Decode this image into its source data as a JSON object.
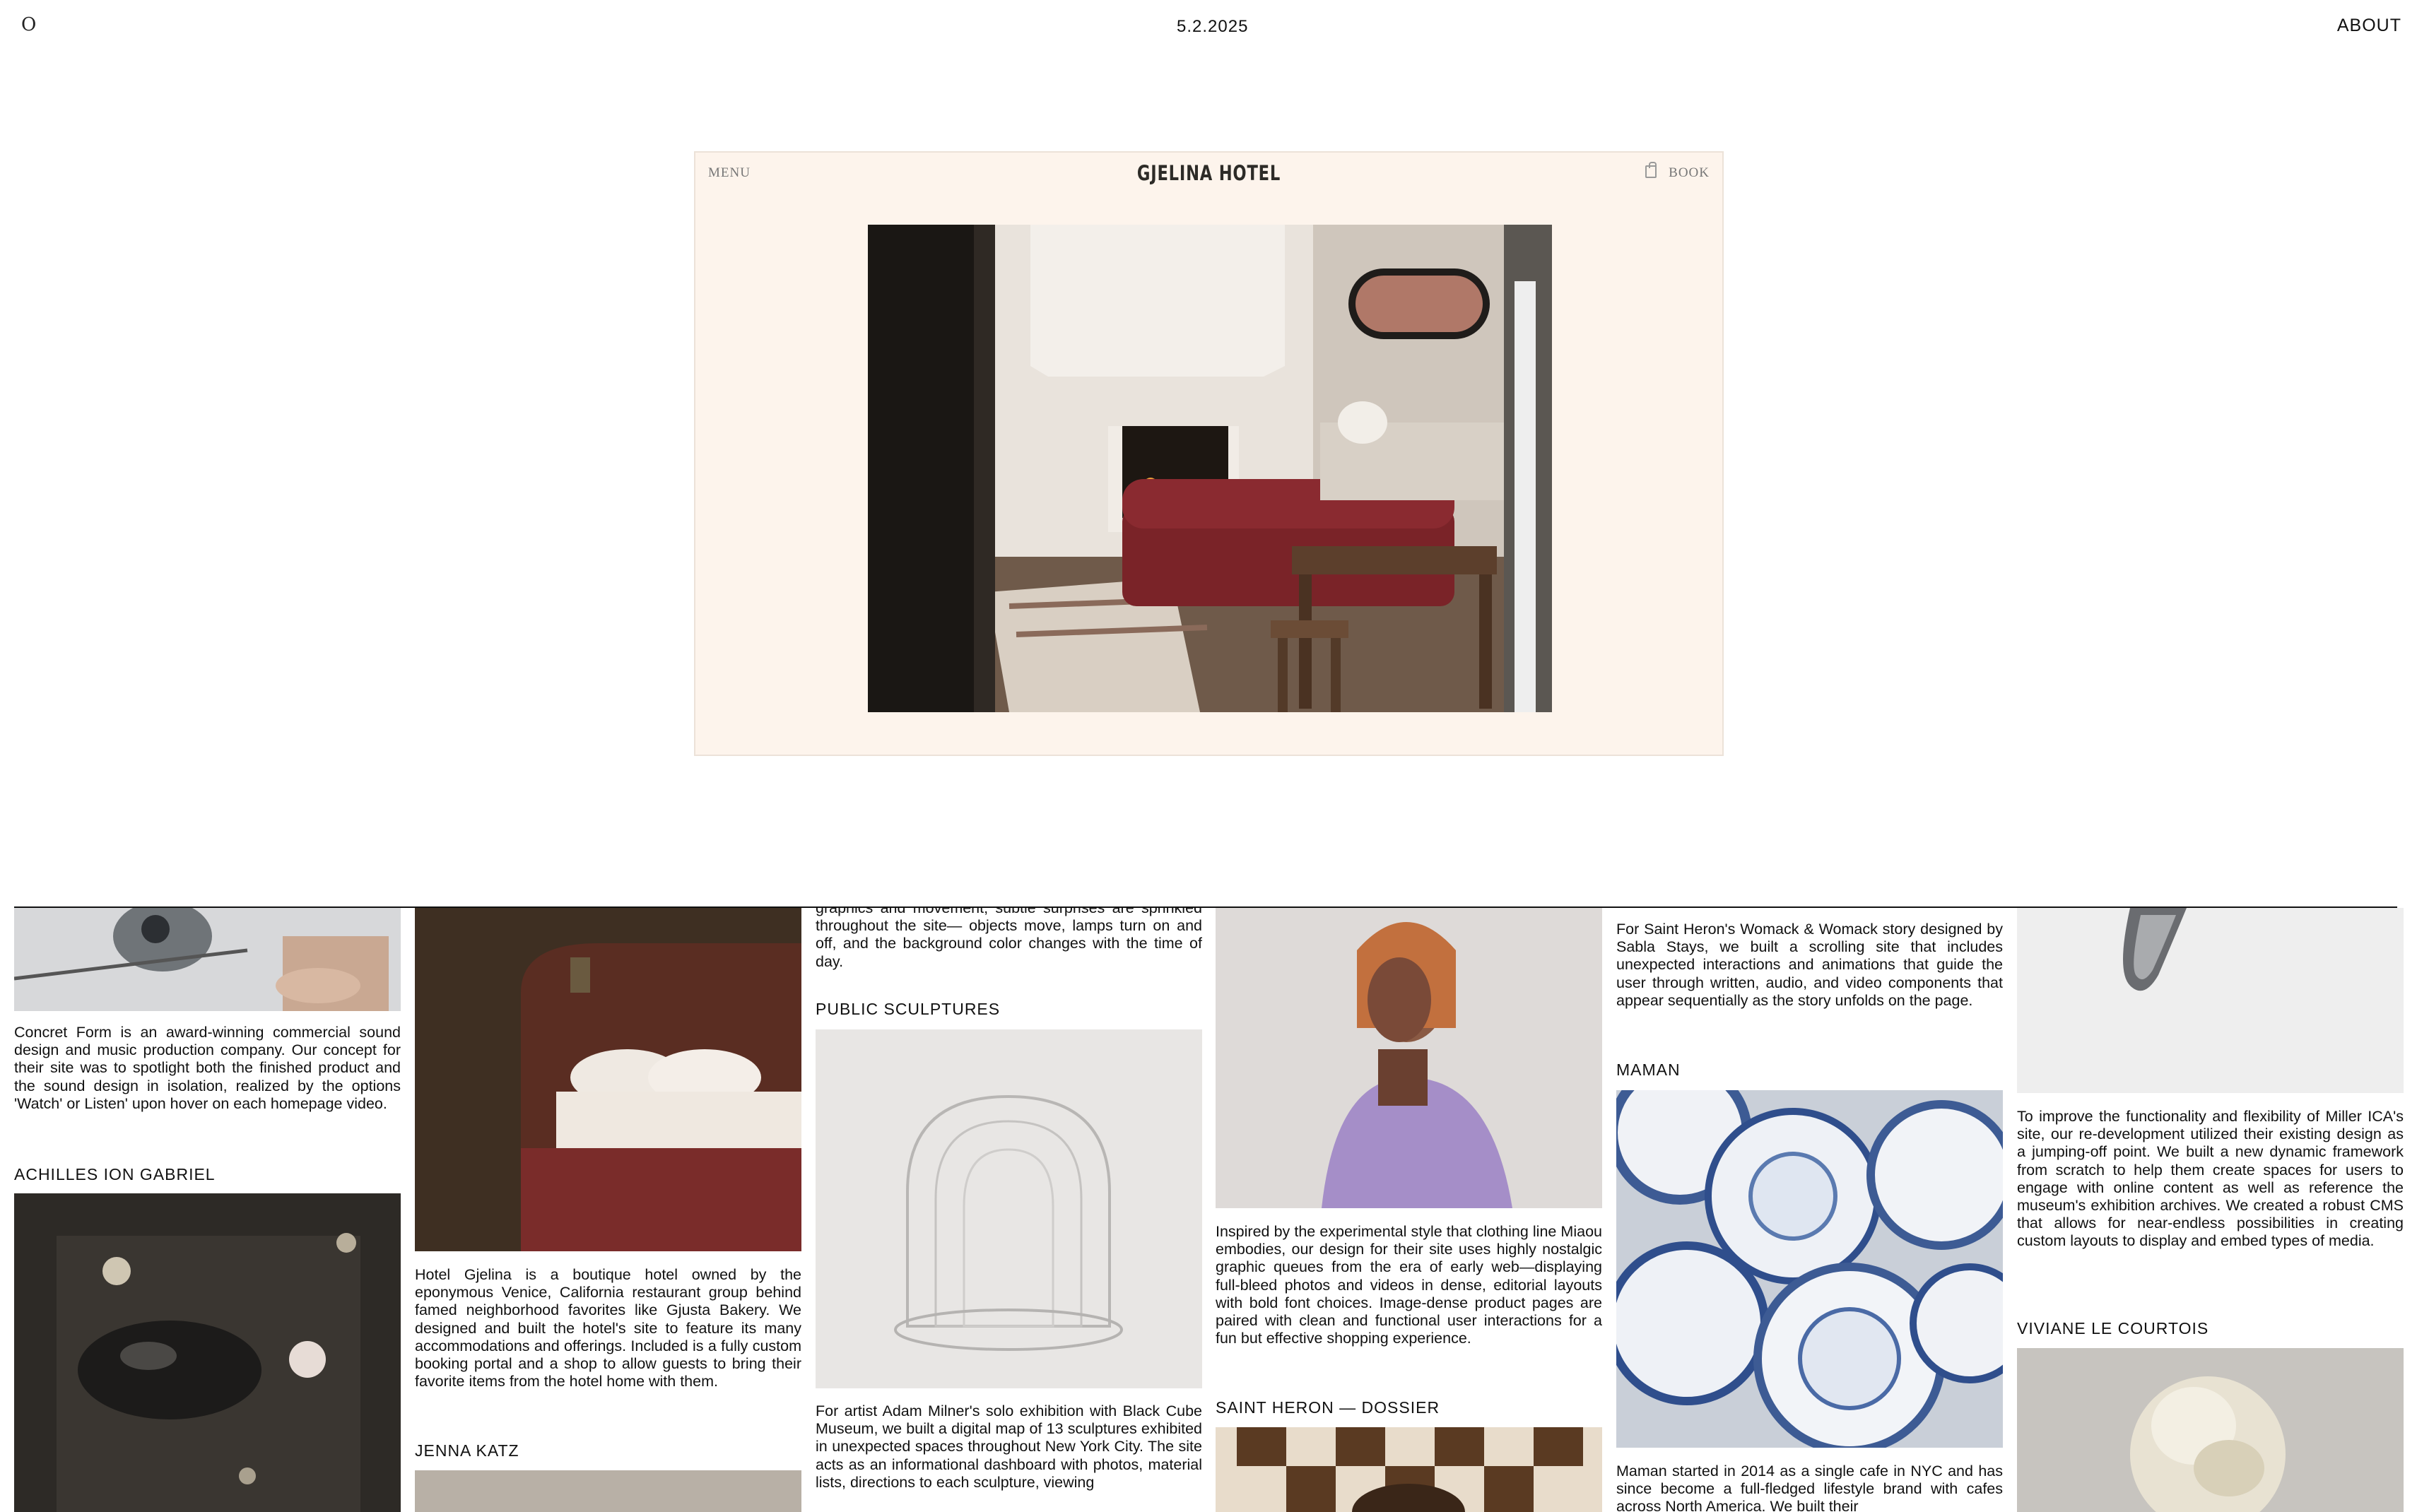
{
  "header": {
    "logo": "O",
    "date": "5.2.2025",
    "about_label": "ABOUT"
  },
  "featured": {
    "menu_label": "MENU",
    "site_title": "GJELINA HOTEL",
    "book_label": "BOOK"
  },
  "columns": [
    {
      "items": [
        {
          "text": "Concret Form is an award-winning commercial sound design and music production company. Our concept for their site was to spotlight both the finished product and the sound design in isolation, realized by the options 'Watch' or Listen' upon hover on each homepage video."
        },
        {
          "title": "ACHILLES ION GABRIEL"
        }
      ]
    },
    {
      "items": [
        {
          "text": "Hotel Gjelina is a boutique hotel owned by the eponymous Venice, California restaurant group behind famed neighborhood favorites like Gjusta Bakery. We designed and built the hotel's site to feature its many accommodations and offerings. Included is a fully custom booking portal and a shop to allow guests to bring their favorite items from the hotel home with them."
        },
        {
          "title": "JENNA KATZ"
        }
      ]
    },
    {
      "items": [
        {
          "text_top": "graphics and movement; subtle surprises are sprinkled throughout the site— objects move, lamps turn on and off, and the background color changes with the time of day."
        },
        {
          "title": "PUBLIC SCULPTURES"
        },
        {
          "text": "For artist Adam Milner's solo exhibition with Black Cube Museum, we built a digital map of 13 sculptures exhibited in unexpected spaces throughout New York City. The site acts as an informational dashboard with photos, material lists, directions to each sculpture, viewing"
        }
      ]
    },
    {
      "items": [
        {
          "text": "Inspired by the experimental style that clothing line Miaou embodies, our design for their site uses highly nostalgic graphic queues from the era of early web—displaying full-bleed photos and videos in dense, editorial layouts with bold font choices. Image-dense product pages are paired with clean and functional user interactions for a fun but effective shopping experience."
        },
        {
          "title": "SAINT HERON — DOSSIER"
        }
      ]
    },
    {
      "items": [
        {
          "text_top": "For Saint Heron's Womack & Womack story designed by Sabla Stays, we built a scrolling site that includes unexpected interactions and animations that guide the user through written, audio, and video components that appear sequentially as the story unfolds on the page."
        },
        {
          "title": "MAMAN"
        },
        {
          "text": "Maman started in 2014 as a single cafe in NYC and has since become a full-fledged lifestyle brand with cafes across North America. We built their"
        }
      ]
    },
    {
      "items": [
        {
          "text": "To improve the functionality and flexibility of Miller ICA's site, our re-development utilized their existing design as a jumping-off point. We built a new dynamic framework from scratch to help them create spaces for users to engage with online content as well as reference the museum's exhibition archives. We created a robust CMS that allows for near-endless possibilities in creating custom layouts to display and embed types of media."
        },
        {
          "title": "VIVIANE LE COURTOIS"
        }
      ]
    }
  ],
  "colors": {
    "preview_bg": "#fdf4ec",
    "text": "#111111"
  }
}
